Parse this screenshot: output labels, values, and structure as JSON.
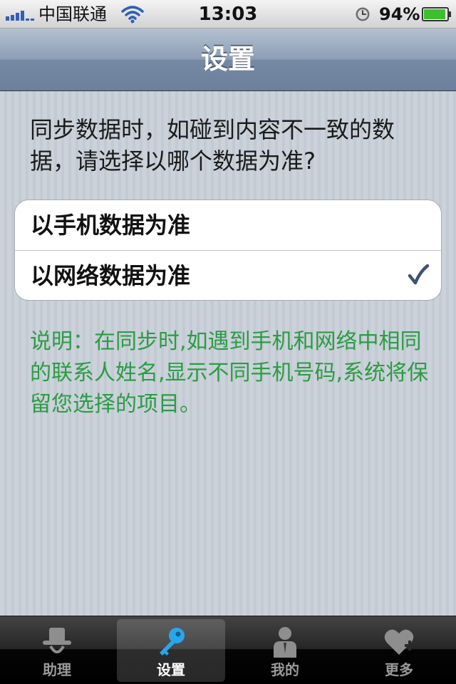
{
  "status_bar": {
    "carrier": "中国联通",
    "time": "13:03",
    "battery_percent": "94%",
    "battery_level": 0.94
  },
  "nav": {
    "title": "设置"
  },
  "question": "同步数据时，如碰到内容不一致的数据，请选择以哪个数据为准?",
  "options": [
    {
      "label": "以手机数据为准",
      "selected": false
    },
    {
      "label": "以网络数据为准",
      "selected": true
    }
  ],
  "note": "说明：在同步时,如遇到手机和网络中相同的联系人姓名,显示不同手机号码,系统将保留您选择的项目。",
  "tabs": [
    {
      "label": "助理",
      "icon": "hat-icon",
      "active": false
    },
    {
      "label": "设置",
      "icon": "key-icon",
      "active": true
    },
    {
      "label": "我的",
      "icon": "person-icon",
      "active": false
    },
    {
      "label": "更多",
      "icon": "heart-plus-icon",
      "active": false
    }
  ],
  "colors": {
    "note_text": "#2b9c44",
    "check": "#3c5478",
    "key_icon": "#2aa6e8"
  }
}
